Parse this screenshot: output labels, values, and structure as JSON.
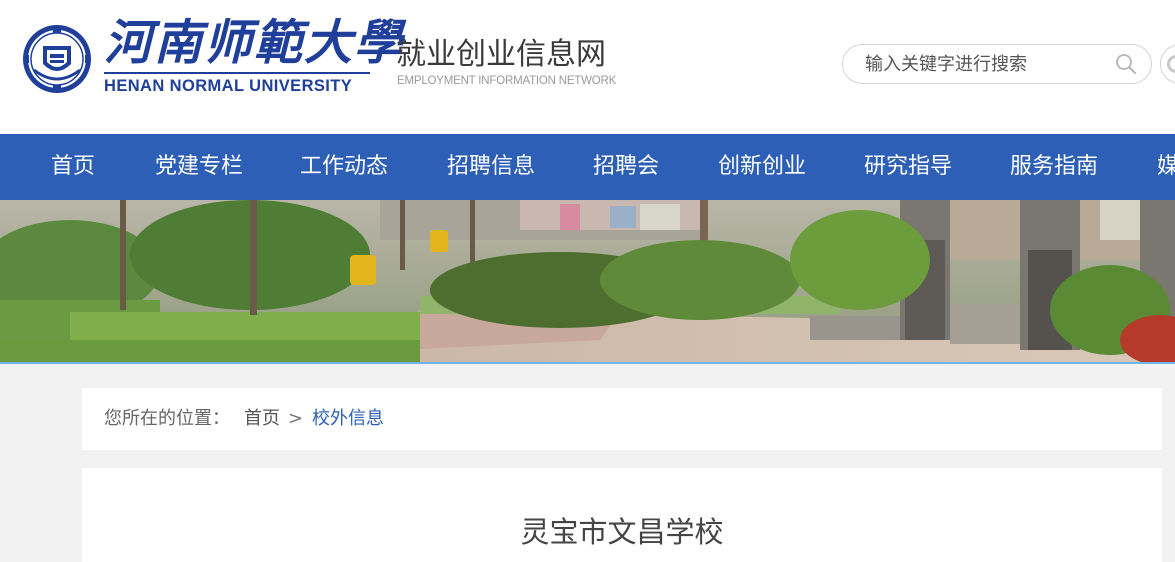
{
  "header": {
    "university_cn": "河南师範大學",
    "university_en": "HENAN NORMAL UNIVERSITY",
    "site_title_cn": "就业创业信息网",
    "site_title_en": "EMPLOYMENT INFORMATION NETWORK",
    "emblem_icon": "university-emblem-icon",
    "brand_color": "#1f3f9a"
  },
  "search": {
    "placeholder": "输入关键字进行搜索",
    "value": "",
    "icon": "search-icon"
  },
  "nav": {
    "color": "#2c5fb5",
    "items": [
      {
        "label": "首页"
      },
      {
        "label": "党建专栏"
      },
      {
        "label": "工作动态"
      },
      {
        "label": "招聘信息"
      },
      {
        "label": "招聘会"
      },
      {
        "label": "创新创业"
      },
      {
        "label": "研究指导"
      },
      {
        "label": "服务指南"
      },
      {
        "label": "媒"
      }
    ]
  },
  "breadcrumb": {
    "label": "您所在的位置：",
    "home": "首页",
    "separator": ">",
    "current": "校外信息",
    "current_color": "#2c5fb5"
  },
  "article": {
    "title": "灵宝市文昌学校"
  }
}
